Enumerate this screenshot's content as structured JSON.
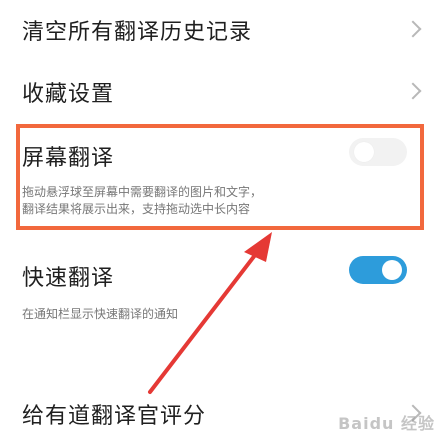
{
  "settings": {
    "clear_history": {
      "title": "清空所有翻译历史记录"
    },
    "favorites": {
      "title": "收藏设置"
    },
    "screen_translate": {
      "title": "屏幕翻译",
      "desc_line1": "拖动悬浮球至屏幕中需要翻译的图片和文字，",
      "desc_line2": "翻译结果将展示出来，支持拖动选中长内容",
      "enabled": false
    },
    "quick_translate": {
      "title": "快速翻译",
      "desc": "在通知栏显示快速翻译的通知",
      "enabled": true
    },
    "rate_app": {
      "title": "给有道翻译官评分"
    }
  },
  "watermark": {
    "text": "Baidu 经验"
  },
  "colors": {
    "accent": "#2d9cdb",
    "highlight": "#f2683d",
    "arrow": "#e53935"
  }
}
